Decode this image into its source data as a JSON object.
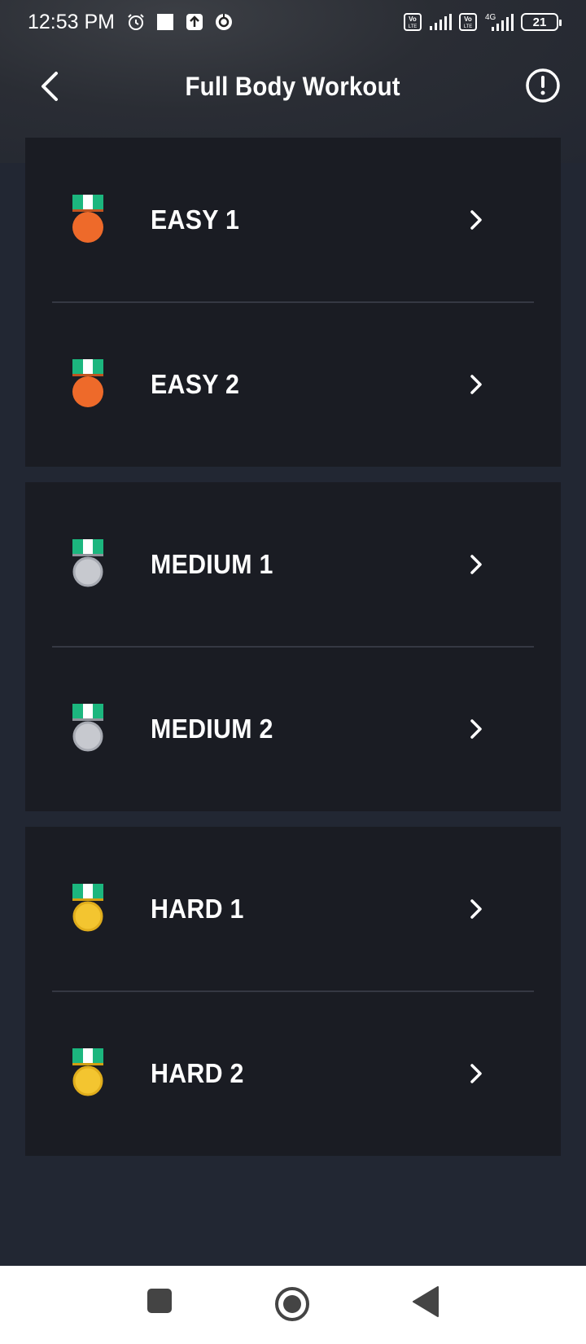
{
  "status_bar": {
    "time": "12:53 PM",
    "left_icons": [
      "alarm-icon",
      "square-notification-icon",
      "upload-icon",
      "vpn-icon"
    ],
    "right_icons": [
      "volte-icon",
      "signal-icon",
      "volte-icon",
      "4g-signal-icon"
    ],
    "network_label": "4G",
    "battery": "21"
  },
  "header": {
    "title": "Full Body Workout",
    "back_icon": "chevron-left-icon",
    "info_icon": "info-circle-icon"
  },
  "groups": [
    {
      "medal_color": "#ee6a2a",
      "rows": [
        {
          "label": "EASY 1"
        },
        {
          "label": "EASY 2"
        }
      ]
    },
    {
      "medal_color": "#c7c9cf",
      "rows": [
        {
          "label": "MEDIUM 1"
        },
        {
          "label": "MEDIUM 2"
        }
      ]
    },
    {
      "medal_color": "#f3c530",
      "rows": [
        {
          "label": "HARD 1"
        },
        {
          "label": "HARD 2"
        }
      ]
    }
  ],
  "colors": {
    "background": "#222733",
    "card": "#1a1c23",
    "ribbon_green": "#1cb67e",
    "divider": "#353843"
  },
  "nav_bar": {
    "buttons": [
      "recents-square-icon",
      "home-circle-icon",
      "back-triangle-icon"
    ]
  }
}
